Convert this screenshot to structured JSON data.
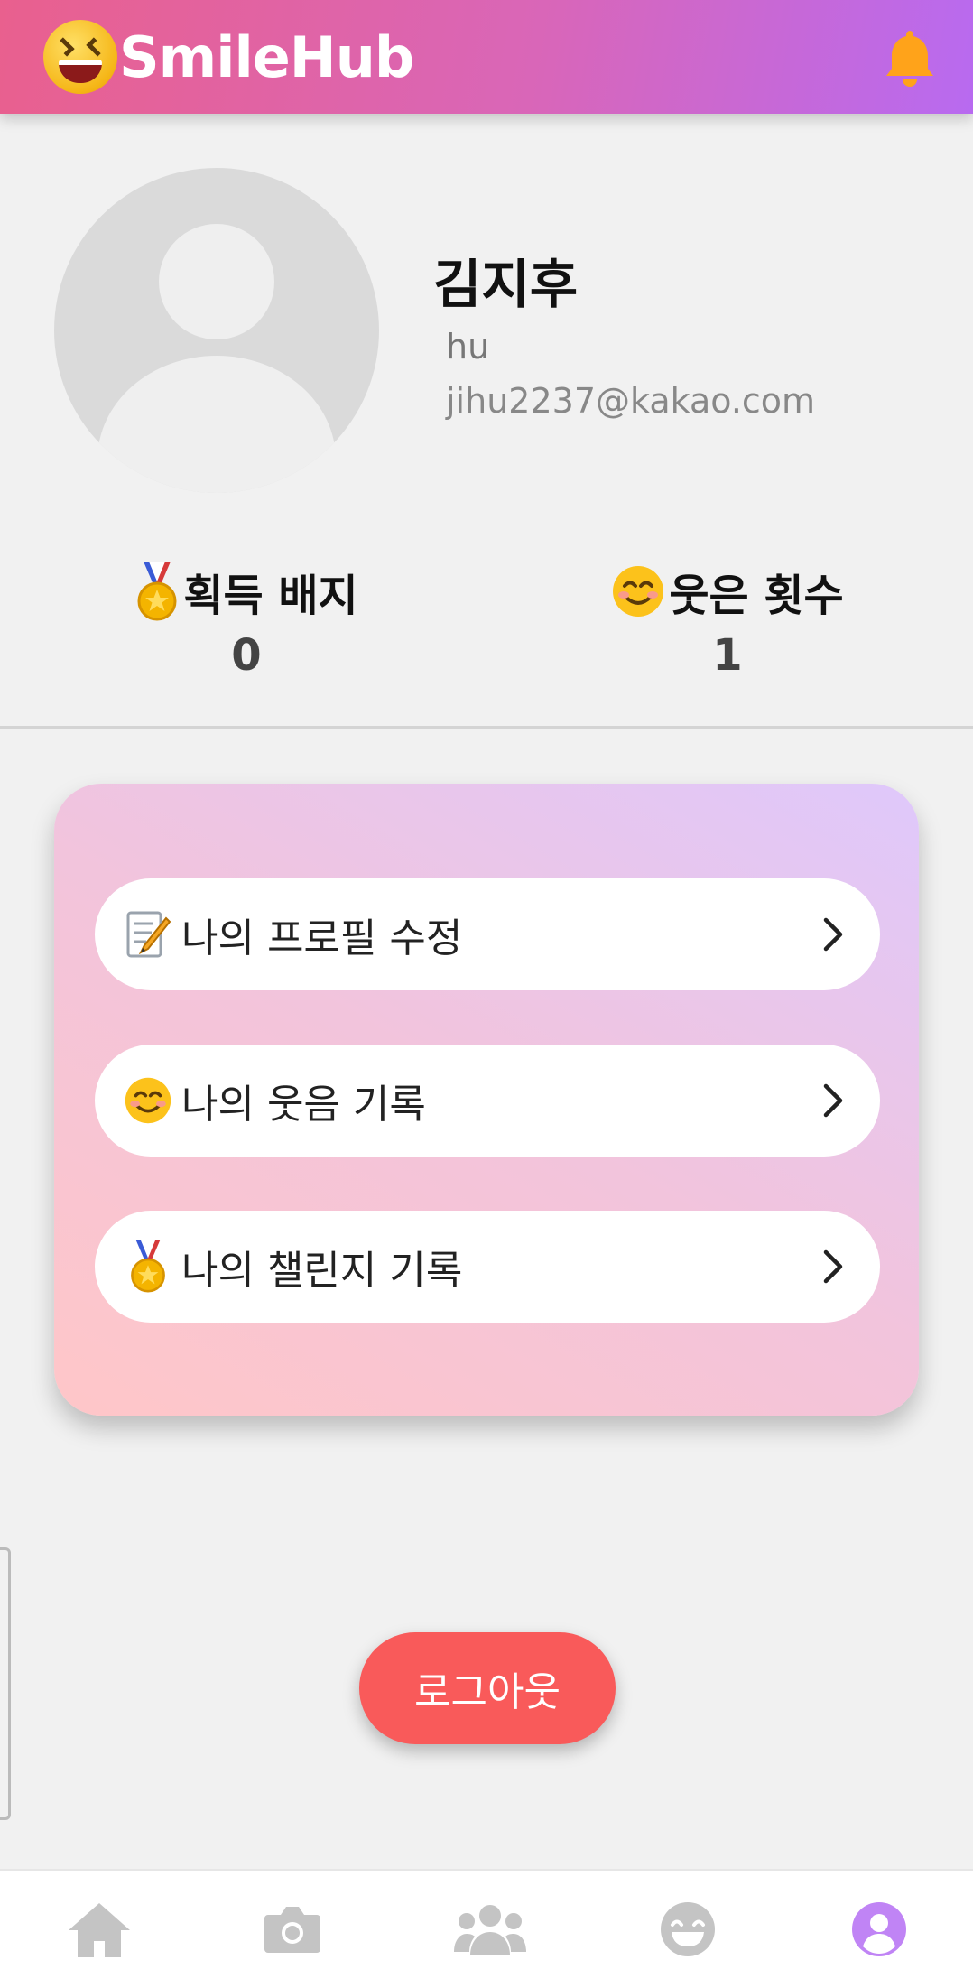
{
  "app": {
    "name": "SmileHub"
  },
  "profile": {
    "name": "김지후",
    "nickname": "hu",
    "email": "jihu2237@kakao.com"
  },
  "stats": {
    "badges_label": "획득 배지",
    "badges_value": "0",
    "smiles_label": "웃은 횟수",
    "smiles_value": "1"
  },
  "menu": {
    "items": [
      {
        "icon": "memo-icon",
        "label": "나의 프로필 수정"
      },
      {
        "icon": "smiling-face-icon",
        "label": "나의 웃음 기록"
      },
      {
        "icon": "medal-icon",
        "label": "나의 챌린지 기록"
      }
    ]
  },
  "logout_label": "로그아웃",
  "nav": {
    "items": [
      {
        "icon": "home-icon"
      },
      {
        "icon": "camera-icon"
      },
      {
        "icon": "users-icon"
      },
      {
        "icon": "smile-icon"
      },
      {
        "icon": "profile-icon",
        "active": true
      }
    ],
    "active_color": "#c084f5",
    "inactive_color": "#c4c4c4"
  },
  "colors": {
    "header_start": "#e9608e",
    "header_end": "#b86af0",
    "bell": "#ffa31a",
    "logout": "#f95a5a"
  }
}
